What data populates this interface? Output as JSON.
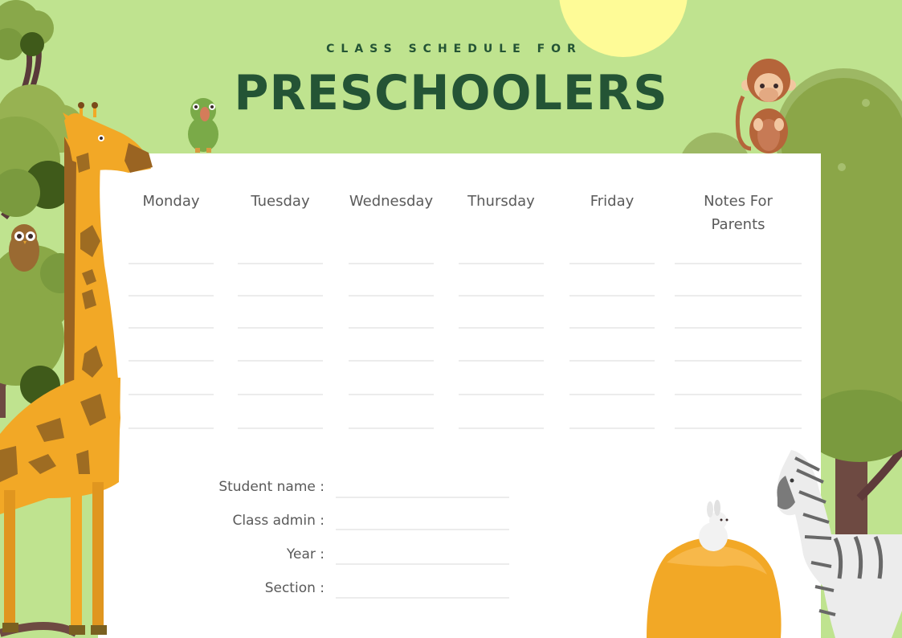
{
  "header": {
    "subtitle": "CLASS SCHEDULE FOR",
    "title": "PRESCHOOLERS"
  },
  "schedule": {
    "columns": [
      {
        "label": "Monday"
      },
      {
        "label": "Tuesday"
      },
      {
        "label": "Wednesday"
      },
      {
        "label": "Thursday"
      },
      {
        "label": "Friday"
      },
      {
        "label": "Notes For\nParents"
      }
    ],
    "rows_per_column": 6
  },
  "form": {
    "fields": [
      {
        "label": "Student name :",
        "value": ""
      },
      {
        "label": "Class admin :",
        "value": ""
      },
      {
        "label": "Year :",
        "value": ""
      },
      {
        "label": "Section :",
        "value": ""
      }
    ]
  },
  "illustrations": [
    "sun",
    "trees",
    "giraffe",
    "owl",
    "parrot",
    "monkey",
    "haystack",
    "rabbit",
    "zebra"
  ],
  "colors": {
    "background": "#bfe38f",
    "title": "#245435",
    "card": "#ffffff",
    "text": "#5a5a5a",
    "sun": "#fefb97"
  }
}
